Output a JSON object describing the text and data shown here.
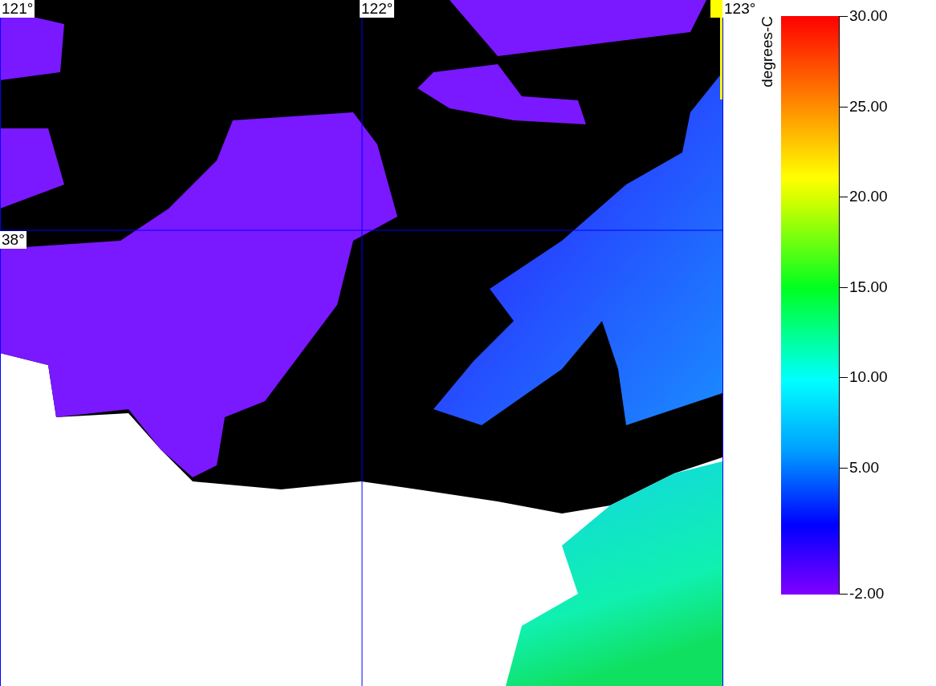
{
  "map": {
    "grid_labels": [
      {
        "text": "121°",
        "kind": "lon"
      },
      {
        "text": "122°",
        "kind": "lon"
      },
      {
        "text": "123°",
        "kind": "lon"
      },
      {
        "text": "38°",
        "kind": "lat"
      }
    ]
  },
  "colorbar": {
    "label": "degrees-C",
    "ticks": [
      {
        "text": "30.00",
        "level": 1
      },
      {
        "text": "25.00",
        "level": 0.84375
      },
      {
        "text": "20.00",
        "level": 0.6875
      },
      {
        "text": "15.00",
        "level": 0.53125
      },
      {
        "text": "10.00",
        "level": 0.375
      },
      {
        "text": "5.00",
        "level": 0.21875
      },
      {
        "text": "-2.00",
        "level": 0
      }
    ]
  }
}
